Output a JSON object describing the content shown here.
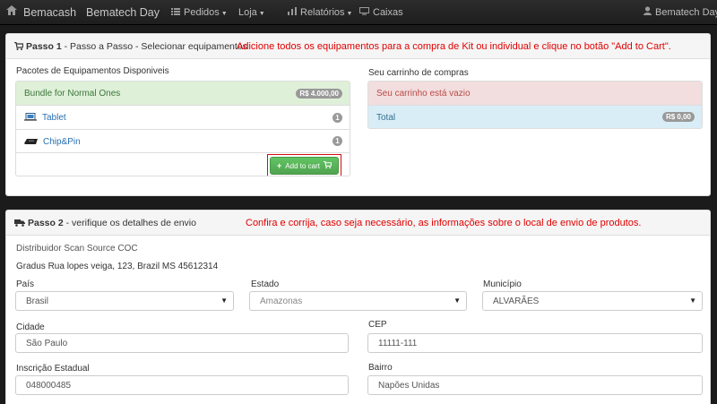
{
  "navbar": {
    "brand_1": "Bemacash",
    "brand_2": "Bematech Day",
    "menu": [
      {
        "label": "Pedidos",
        "icon": "list-icon"
      },
      {
        "label": "Loja",
        "icon": null
      },
      {
        "label": "Relatórios",
        "icon": null
      },
      {
        "label": "Caixas",
        "icon": "monitor-icon"
      }
    ],
    "user": "Bematech Day"
  },
  "step1": {
    "title_bold": "Passo 1",
    "title_rest": " - Passo a Passo - Selecionar equipamentos",
    "note": "Adicione todos os equipamentos para a compra de Kit ou individual e clique no botão \"Add to Cart\".",
    "packages_label": "Pacotes de Equipamentos Disponiveis",
    "bundle": {
      "name": "Bundle for Normal Ones",
      "price": "R$ 4.000,00"
    },
    "items": [
      {
        "name": "Tablet",
        "count": "1",
        "icon": "tablet-icon"
      },
      {
        "name": "Chip&Pin",
        "count": "1",
        "icon": "card-reader-icon"
      }
    ],
    "add_to_cart": "Add to cart",
    "cart_label": "Seu carrinho de compras",
    "cart_empty": "Seu carrinho está vazio",
    "total_label": "Total",
    "total_value": "R$ 0,00"
  },
  "step2": {
    "title_bold": "Passo 2",
    "title_rest": " - verifique os detalhes de envio",
    "note": "Confira e corrija, caso seja necessário, as informações sobre o local de envio de produtos.",
    "distributor": "Distribuidor Scan Source COC",
    "address": "Gradus Rua lopes veiga, 123, Brazil MS 45612314",
    "fields": {
      "pais": {
        "label": "País",
        "value": "Brasil"
      },
      "estado": {
        "label": "Estado",
        "value": "Amazonas"
      },
      "municipio": {
        "label": "Município",
        "value": "ALVARÃES"
      },
      "cidade": {
        "label": "Cidade",
        "value": "São Paulo"
      },
      "cep": {
        "label": "CEP",
        "value": "11111-111"
      },
      "inscricao": {
        "label": "Inscrição Estadual",
        "value": "048000485"
      },
      "bairro": {
        "label": "Bairro",
        "value": "Napões Unidas"
      }
    }
  },
  "colors": {
    "note_red": "#e00000",
    "bundle_bg": "#dff0d8",
    "cart_empty_bg": "#f2dede",
    "total_bg": "#d9edf7",
    "button_green": "#5bb75b"
  }
}
